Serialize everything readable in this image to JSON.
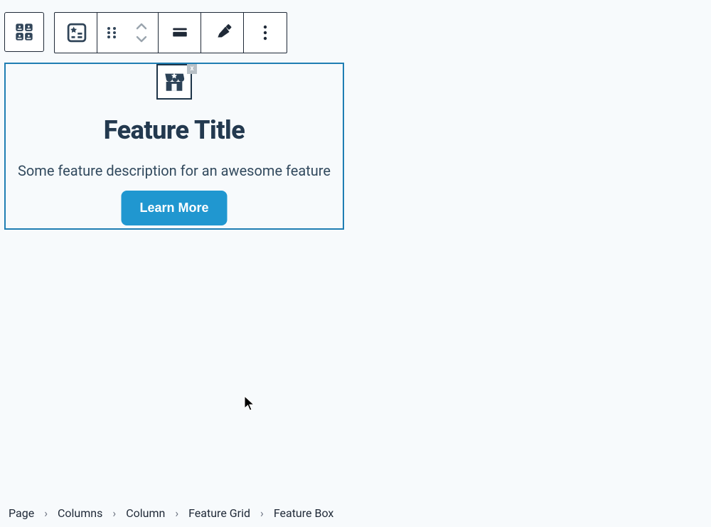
{
  "feature": {
    "title": "Feature Title",
    "description": "Some feature description for an awesome feature",
    "button_label": "Learn More",
    "icon_close_label": "x"
  },
  "breadcrumb": {
    "items": [
      "Page",
      "Columns",
      "Column",
      "Feature Grid",
      "Feature Box"
    ]
  },
  "colors": {
    "primary": "#2097d0",
    "outline": "#1f7eb3",
    "text_dark": "#23394f"
  }
}
